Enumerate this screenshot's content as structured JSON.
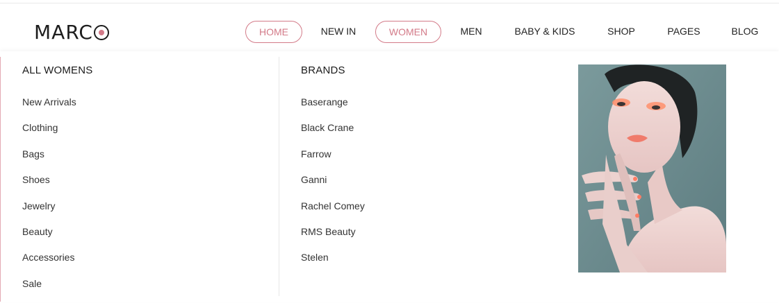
{
  "brand": {
    "logo_text": "MARC",
    "accent_color": "#d37a88"
  },
  "nav": {
    "items": [
      {
        "label": "HOME",
        "style": "pill"
      },
      {
        "label": "NEW IN",
        "style": "plain"
      },
      {
        "label": "WOMEN",
        "style": "pill"
      },
      {
        "label": "MEN",
        "style": "plain"
      },
      {
        "label": "BABY & KIDS",
        "style": "plain"
      },
      {
        "label": "SHOP",
        "style": "plain"
      },
      {
        "label": "PAGES",
        "style": "plain"
      },
      {
        "label": "BLOG",
        "style": "plain"
      }
    ]
  },
  "mega_menu": {
    "all_womens": {
      "title": "ALL WOMENS",
      "links": [
        "New Arrivals",
        "Clothing",
        "Bags",
        "Shoes",
        "Jewelry",
        "Beauty",
        "Accessories",
        "Sale"
      ]
    },
    "brands": {
      "title": "BRANDS",
      "links": [
        "Baserange",
        "Black Crane",
        "Farrow",
        "Ganni",
        "Rachel Comey",
        "RMS Beauty",
        "Stelen"
      ]
    },
    "promo_image": {
      "subject": "beauty-model-portrait"
    }
  }
}
